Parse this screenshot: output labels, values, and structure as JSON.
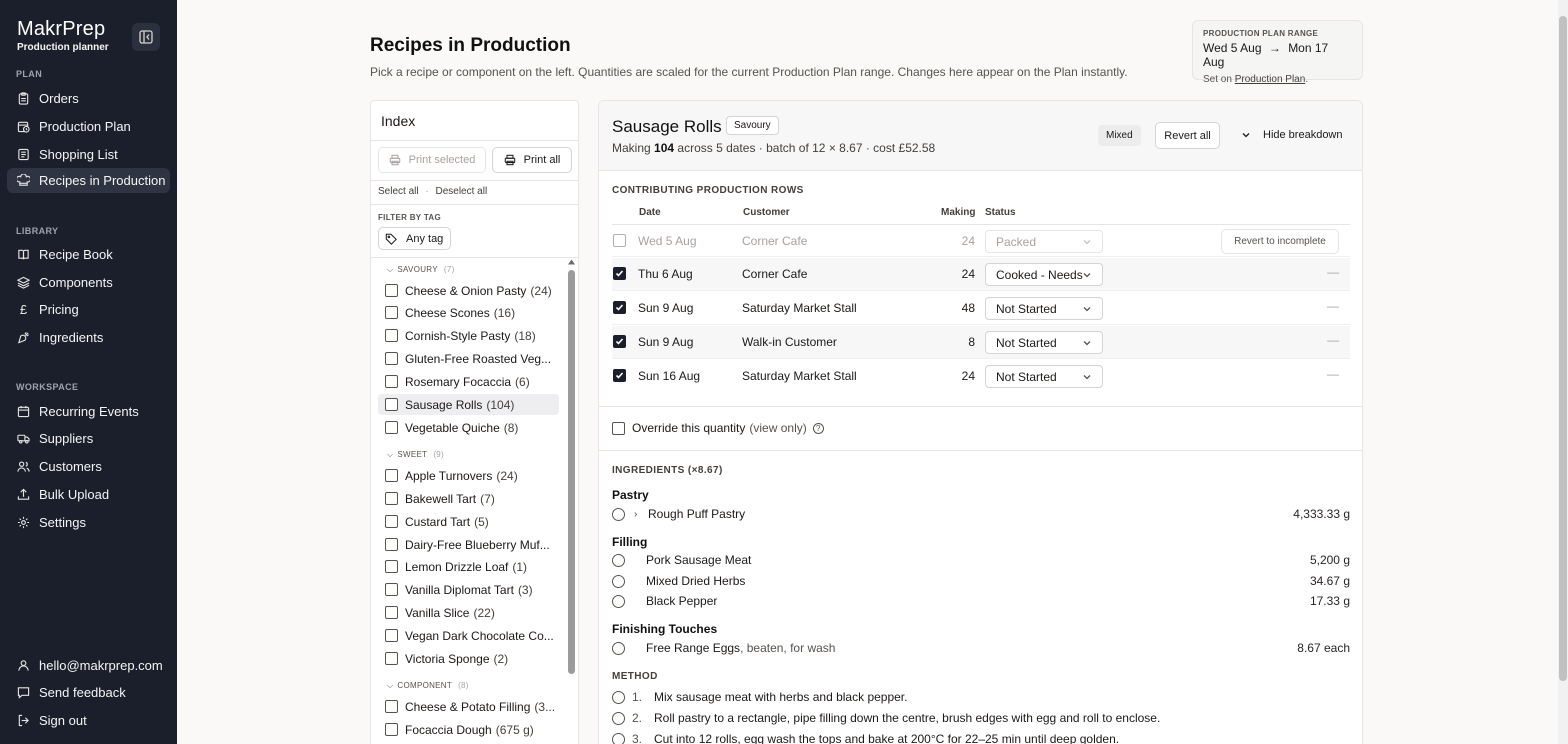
{
  "brand": {
    "name": "MakrPrep",
    "subtitle": "Production planner"
  },
  "sidebar": {
    "sections": {
      "plan": "PLAN",
      "library": "LIBRARY",
      "workspace": "WORKSPACE"
    },
    "plan_items": [
      {
        "label": "Orders",
        "icon": "clipboard-icon"
      },
      {
        "label": "Production Plan",
        "icon": "calendar-clock-icon"
      },
      {
        "label": "Shopping List",
        "icon": "cart-icon"
      },
      {
        "label": "Recipes in Production",
        "icon": "chef-hat-icon"
      }
    ],
    "library_items": [
      {
        "label": "Recipe Book",
        "icon": "book-icon"
      },
      {
        "label": "Components",
        "icon": "layers-icon"
      },
      {
        "label": "Pricing",
        "icon": "pound-icon"
      },
      {
        "label": "Ingredients",
        "icon": "carrot-icon"
      }
    ],
    "workspace_items": [
      {
        "label": "Recurring Events",
        "icon": "calendar-icon"
      },
      {
        "label": "Suppliers",
        "icon": "truck-icon"
      },
      {
        "label": "Customers",
        "icon": "users-icon"
      },
      {
        "label": "Bulk Upload",
        "icon": "upload-icon"
      },
      {
        "label": "Settings",
        "icon": "gear-icon"
      }
    ],
    "footer": {
      "email": "hello@makrprep.com",
      "feedback": "Send feedback",
      "signout": "Sign out"
    }
  },
  "header": {
    "title": "Recipes in Production",
    "subtitle": "Pick a recipe or component on the left. Quantities are scaled for the current Production Plan range. Changes here appear on the Plan instantly.",
    "range": {
      "label": "PRODUCTION PLAN RANGE",
      "start": "Wed 5 Aug",
      "arrow": "→",
      "end": "Mon 17 Aug",
      "set_prefix": "Set on ",
      "set_link": "Production Plan",
      "set_suffix": "."
    }
  },
  "index": {
    "title": "Index",
    "print_selected": "Print selected",
    "print_all": "Print all",
    "select_all": "Select all",
    "separator": "·",
    "deselect_all": "Deselect all",
    "filter_label": "FILTER BY TAG",
    "any_tag": "Any tag",
    "groups": [
      {
        "name": "SAVOURY",
        "count": "(7)",
        "items": [
          {
            "name": "Cheese & Onion Pasty",
            "qty": "(24)"
          },
          {
            "name": "Cheese Scones",
            "qty": "(16)"
          },
          {
            "name": "Cornish-Style Pasty",
            "qty": "(18)"
          },
          {
            "name": "Gluten-Free Roasted Veg...",
            "qty": ""
          },
          {
            "name": "Rosemary Focaccia",
            "qty": "(6)"
          },
          {
            "name": "Sausage Rolls",
            "qty": "(104)"
          },
          {
            "name": "Vegetable Quiche",
            "qty": "(8)"
          }
        ]
      },
      {
        "name": "SWEET",
        "count": "(9)",
        "items": [
          {
            "name": "Apple Turnovers",
            "qty": "(24)"
          },
          {
            "name": "Bakewell Tart",
            "qty": "(7)"
          },
          {
            "name": "Custard Tart",
            "qty": "(5)"
          },
          {
            "name": "Dairy-Free Blueberry Muf...",
            "qty": ""
          },
          {
            "name": "Lemon Drizzle Loaf",
            "qty": "(1)"
          },
          {
            "name": "Vanilla Diplomat Tart",
            "qty": "(3)"
          },
          {
            "name": "Vanilla Slice",
            "qty": "(22)"
          },
          {
            "name": "Vegan Dark Chocolate Co...",
            "qty": ""
          },
          {
            "name": "Victoria Sponge",
            "qty": "(2)"
          }
        ]
      },
      {
        "name": "COMPONENT",
        "count": "(8)",
        "items": [
          {
            "name": "Cheese & Potato Filling",
            "qty": "(3..."
          },
          {
            "name": "Focaccia Dough",
            "qty": "(675 g)"
          }
        ]
      }
    ]
  },
  "detail": {
    "title": "Sausage Rolls",
    "tag": "Savoury",
    "meta_prefix": "Making ",
    "meta_count": "104",
    "meta_suffix": " across 5 dates · batch of 12 × 8.67 · cost £52.58",
    "mixed": "Mixed",
    "revert_all": "Revert all",
    "hide_breakdown": "Hide breakdown",
    "rows_label": "CONTRIBUTING PRODUCTION ROWS",
    "columns": {
      "date": "Date",
      "customer": "Customer",
      "making": "Making",
      "status": "Status"
    },
    "rows": [
      {
        "date": "Wed 5 Aug",
        "customer": "Corner Cafe",
        "making": "24",
        "status": "Packed",
        "action": "Revert to incomplete"
      },
      {
        "date": "Thu 6 Aug",
        "customer": "Corner Cafe",
        "making": "24",
        "status": "Cooked - Needs",
        "action": "—"
      },
      {
        "date": "Sun 9 Aug",
        "customer": "Saturday Market Stall",
        "making": "48",
        "status": "Not Started",
        "action": "—"
      },
      {
        "date": "Sun 9 Aug",
        "customer": "Walk-in Customer",
        "making": "8",
        "status": "Not Started",
        "action": "—"
      },
      {
        "date": "Sun 16 Aug",
        "customer": "Saturday Market Stall",
        "making": "24",
        "status": "Not Started",
        "action": "—"
      }
    ],
    "override_label": "Override this quantity",
    "override_note": "(view only)",
    "help": "?",
    "ingredients_label": "INGREDIENTS (×8.67)",
    "ingredient_groups": [
      {
        "name": "Pastry",
        "items": [
          {
            "name": "Rough Puff Pastry",
            "note": "",
            "amount": "4,333.33 g",
            "expandable": true
          }
        ]
      },
      {
        "name": "Filling",
        "items": [
          {
            "name": "Pork Sausage Meat",
            "note": "",
            "amount": "5,200 g"
          },
          {
            "name": "Mixed Dried Herbs",
            "note": "",
            "amount": "34.67 g"
          },
          {
            "name": "Black Pepper",
            "note": "",
            "amount": "17.33 g"
          }
        ]
      },
      {
        "name": "Finishing Touches",
        "items": [
          {
            "name": "Free Range Eggs",
            "note": ", beaten, for wash",
            "amount": "8.67 each"
          }
        ]
      }
    ],
    "method_label": "METHOD",
    "method": [
      {
        "num": "1.",
        "text": "Mix sausage meat with herbs and black pepper."
      },
      {
        "num": "2.",
        "text": "Roll pastry to a rectangle, pipe filling down the centre, brush edges with egg and roll to enclose."
      },
      {
        "num": "3.",
        "text": "Cut into 12 rolls, egg wash the tops and bake at 200°C for 22–25 min until deep golden."
      }
    ]
  }
}
